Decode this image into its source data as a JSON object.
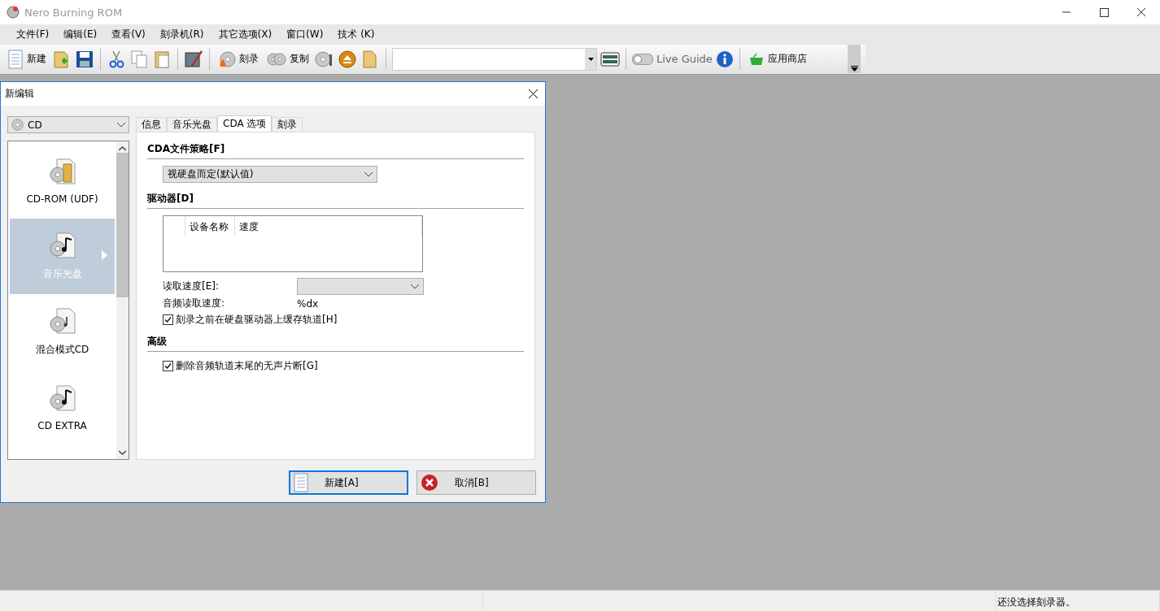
{
  "window": {
    "title": "Nero Burning ROM"
  },
  "menu": [
    "文件(F)",
    "编辑(E)",
    "查看(V)",
    "刻录机(R)",
    "其它选项(X)",
    "窗口(W)",
    "技术 (K)"
  ],
  "toolbar": {
    "new_label": "新建",
    "burn_label": "刻录",
    "copy_label": "复制",
    "live_guide": {
      "label": "Live Guide",
      "on": false
    },
    "store_label": "应用商店"
  },
  "dialog": {
    "title": "新编辑",
    "disc_type": "CD",
    "projects": [
      {
        "label": "CD-ROM (UDF)",
        "kind": "data",
        "selected": false
      },
      {
        "label": "音乐光盘",
        "kind": "audio",
        "selected": true
      },
      {
        "label": "混合模式CD",
        "kind": "mixed",
        "selected": false
      },
      {
        "label": "CD EXTRA",
        "kind": "extra",
        "selected": false
      }
    ],
    "tabs": [
      {
        "label": "信息",
        "selected": false
      },
      {
        "label": "音乐光盘",
        "selected": false
      },
      {
        "label": "CDA 选项",
        "selected": true
      },
      {
        "label": "刻录",
        "selected": false
      }
    ],
    "cda_options": {
      "policy_heading": "CDA文件策略[F]",
      "policy_value": "视硬盘而定(默认值)",
      "drive_heading": "驱动器[D]",
      "drive_columns": [
        "设备名称",
        "速度"
      ],
      "read_speed_label": "读取速度[E]:",
      "audio_speed_label": "音频读取速度:",
      "audio_speed_value": "%dx",
      "cache_option": {
        "label": "刻录之前在硬盘驱动器上缓存轨道[H]",
        "checked": true
      },
      "advanced_heading": "高级",
      "silence_option": {
        "label": "删除音频轨道末尾的无声片断[G]",
        "checked": true
      }
    },
    "buttons": [
      {
        "label": "新建[A]",
        "kind": "new",
        "focused": true
      },
      {
        "label": "取消[B]",
        "kind": "cancel",
        "focused": false
      }
    ]
  },
  "status_bar": {
    "message": "还没选择刻录器。"
  }
}
